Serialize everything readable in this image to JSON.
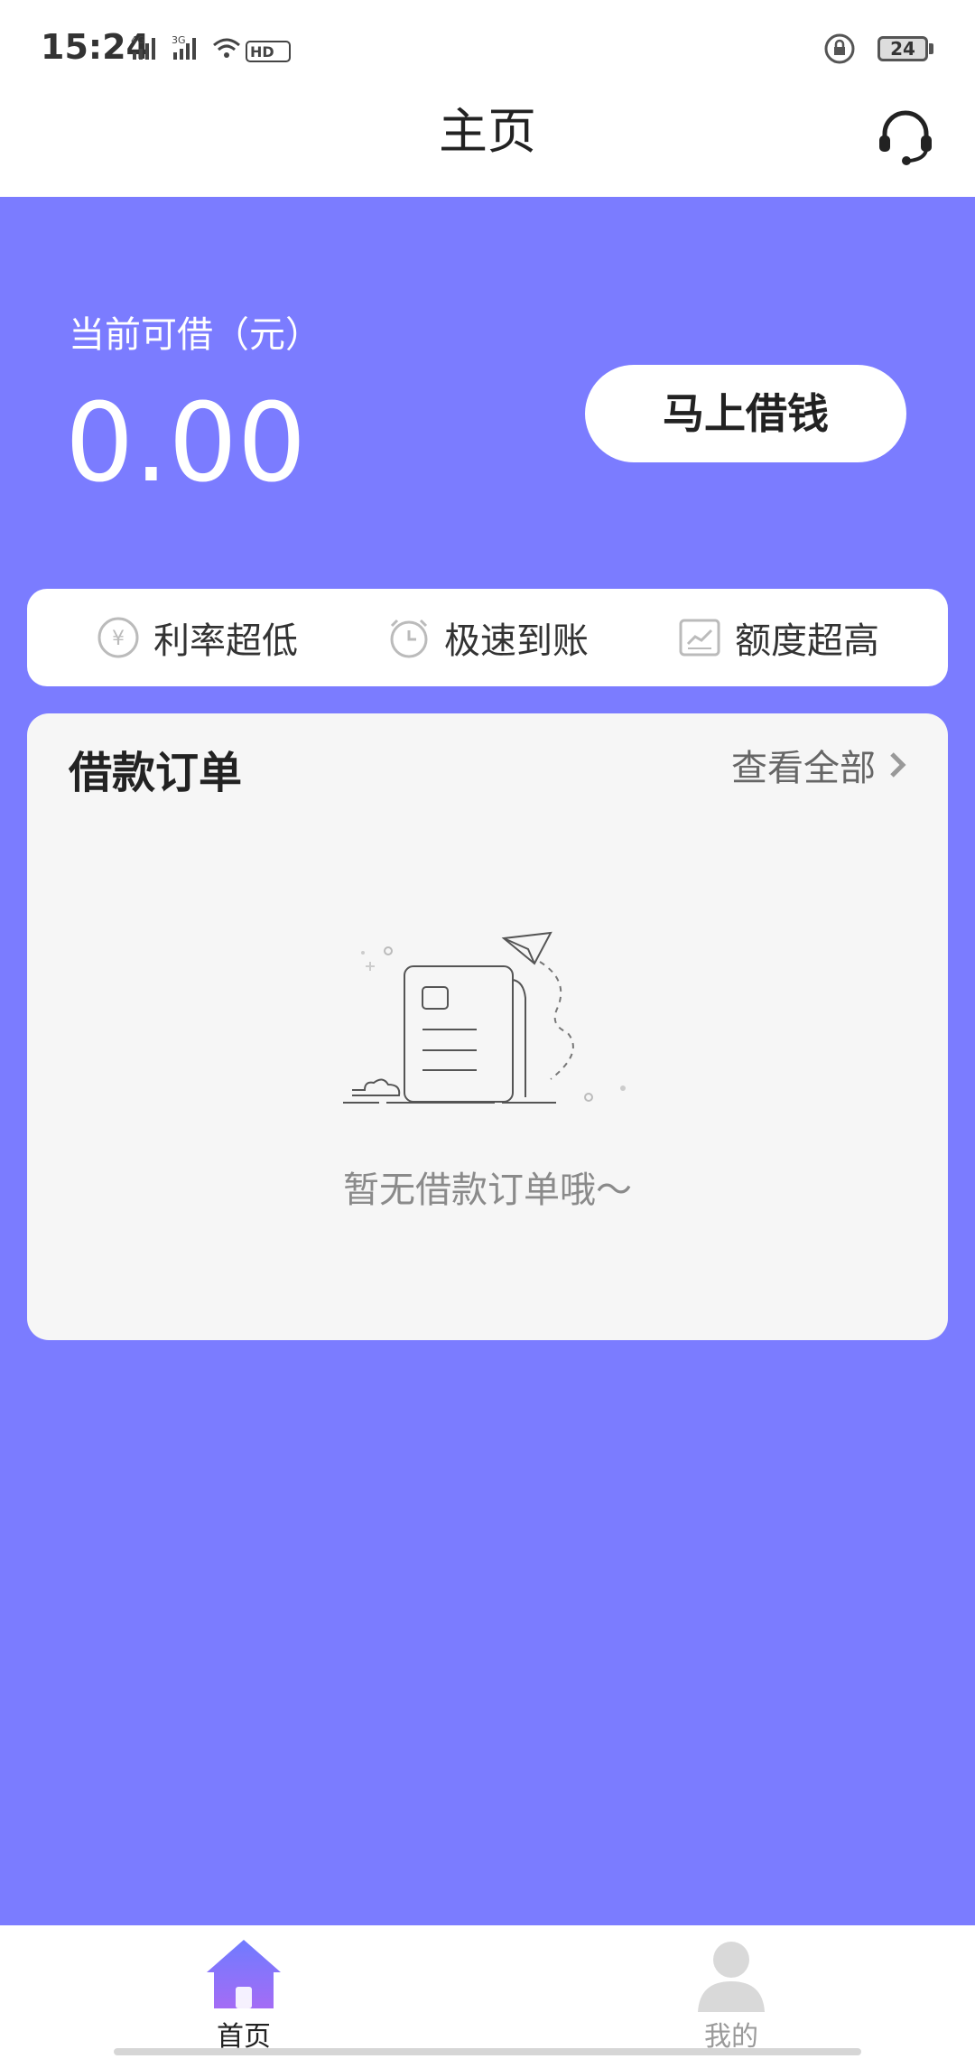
{
  "status_bar": {
    "time": "15:24",
    "battery": "24"
  },
  "header": {
    "title": "主页"
  },
  "summary": {
    "available_label": "当前可借（元）",
    "available_amount": "0.00",
    "borrow_button": "马上借钱"
  },
  "features": [
    {
      "label": "利率超低",
      "icon": "yen-coin-icon"
    },
    {
      "label": "极速到账",
      "icon": "alarm-clock-icon"
    },
    {
      "label": "额度超高",
      "icon": "trend-chart-icon"
    }
  ],
  "orders": {
    "title": "借款订单",
    "view_all": "查看全部",
    "empty_text": "暂无借款订单哦～"
  },
  "tabbar": {
    "tabs": [
      {
        "label": "首页",
        "icon": "home-icon"
      },
      {
        "label": "我的",
        "icon": "person-icon"
      }
    ]
  },
  "colors": {
    "background": "#7b7cff",
    "active_tab_label": "#222222",
    "inactive_tab_label": "#9a9a9a"
  }
}
